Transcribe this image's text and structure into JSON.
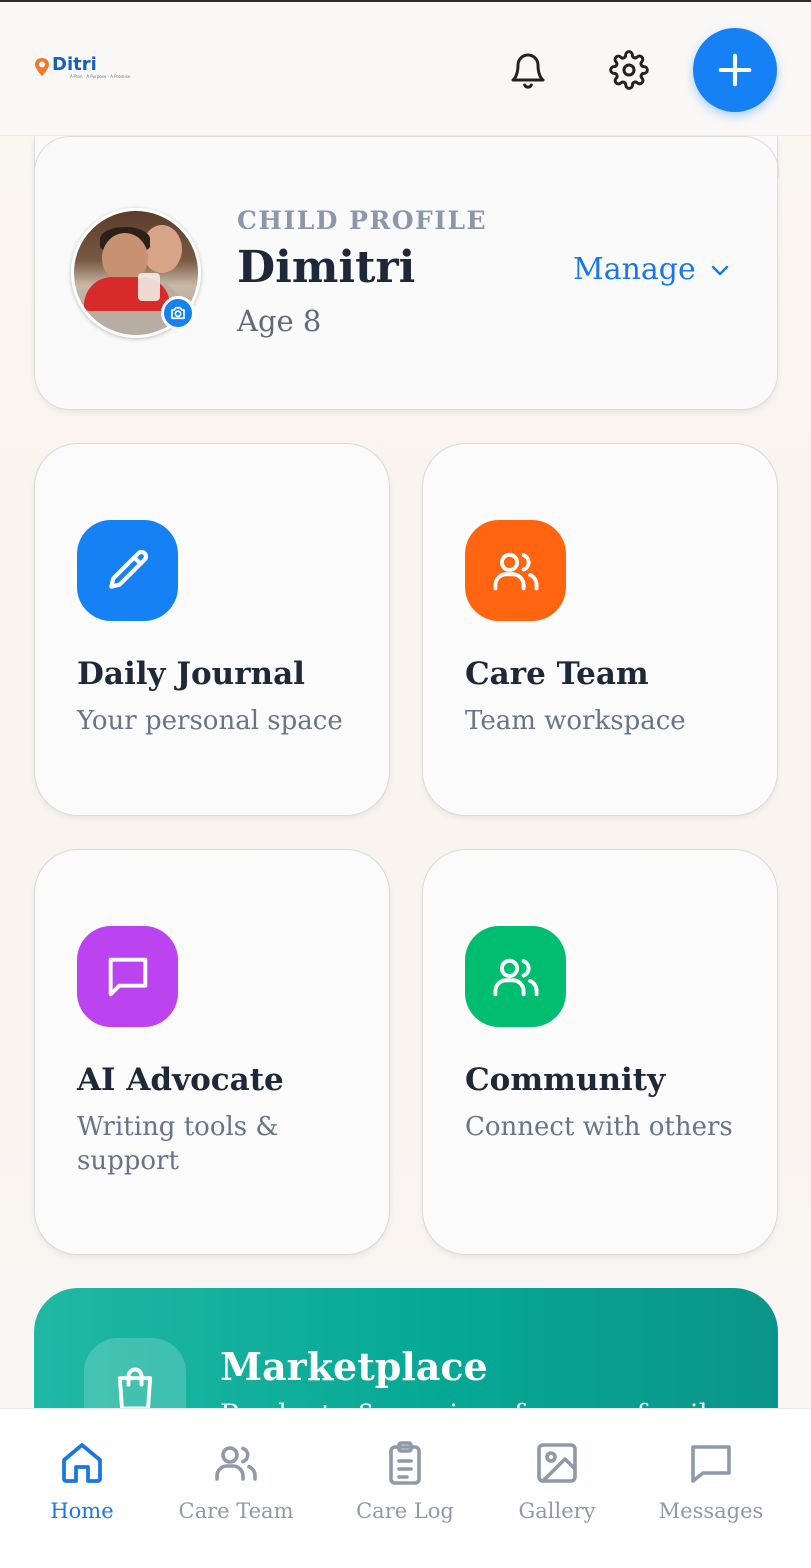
{
  "header": {
    "logo_text": "Ditri",
    "logo_tagline": "A Plan · A Purpose · A Promise",
    "icons": [
      "bell-icon",
      "gear-icon",
      "plus-icon"
    ]
  },
  "profile": {
    "label": "CHILD PROFILE",
    "name": "Dimitri",
    "age": "Age 8",
    "manage_label": "Manage"
  },
  "cards": [
    {
      "title": "Daily Journal",
      "subtitle": "Your personal space",
      "icon": "pencil-icon",
      "color": "#1680f5"
    },
    {
      "title": "Care Team",
      "subtitle": "Team workspace",
      "icon": "users-icon",
      "color": "#ff6411"
    },
    {
      "title": "AI Advocate",
      "subtitle": "Writing tools & support",
      "icon": "message-icon",
      "color": "#bb44f0"
    },
    {
      "title": "Community",
      "subtitle": "Connect with others",
      "icon": "users-icon",
      "color": "#00bd6f"
    }
  ],
  "marketplace": {
    "title": "Marketplace",
    "subtitle": "Products & services for your family",
    "icon": "shopping-bag-icon"
  },
  "nav": [
    {
      "label": "Home",
      "icon": "home-icon",
      "active": true
    },
    {
      "label": "Care Team",
      "icon": "users-icon",
      "active": false
    },
    {
      "label": "Care Log",
      "icon": "clipboard-icon",
      "active": false
    },
    {
      "label": "Gallery",
      "icon": "image-icon",
      "active": false
    },
    {
      "label": "Messages",
      "icon": "message-icon",
      "active": false
    }
  ],
  "colors": {
    "primary": "#1680f5",
    "accent_blue": "#1a78e4",
    "nav_inactive": "#8e99aa",
    "marketplace": "#06a895"
  }
}
